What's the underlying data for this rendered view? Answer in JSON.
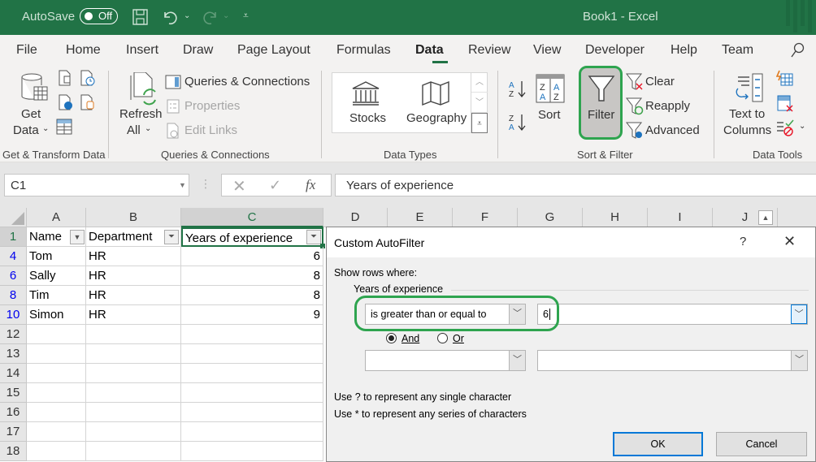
{
  "titlebar": {
    "autosave_label": "AutoSave",
    "autosave_state": "Off",
    "title": "Book1  -  Excel",
    "icons": [
      "save-icon",
      "undo-icon",
      "redo-icon",
      "customize-qat-icon"
    ]
  },
  "menu": {
    "tabs": [
      "File",
      "Home",
      "Insert",
      "Draw",
      "Page Layout",
      "Formulas",
      "Data",
      "Review",
      "View",
      "Developer",
      "Help",
      "Team"
    ],
    "active": "Data",
    "search_icon": "search-icon"
  },
  "ribbon": {
    "get_transform": {
      "get_data_line1": "Get",
      "get_data_line2": "Data",
      "group_label": "Get & Transform Data"
    },
    "queries": {
      "refresh_line1": "Refresh",
      "refresh_line2": "All",
      "queries_connections": "Queries & Connections",
      "properties": "Properties",
      "edit_links": "Edit Links",
      "group_label": "Queries & Connections"
    },
    "data_types": {
      "stocks": "Stocks",
      "geography": "Geography",
      "group_label": "Data Types"
    },
    "sort_filter": {
      "sort": "Sort",
      "filter": "Filter",
      "clear": "Clear",
      "reapply": "Reapply",
      "advanced": "Advanced",
      "group_label": "Sort & Filter"
    },
    "data_tools": {
      "text_to_line1": "Text to",
      "text_to_line2": "Columns",
      "group_label": "Data Tools"
    }
  },
  "formula_bar": {
    "name_box": "C1",
    "formula": "Years of experience",
    "fx": "fx"
  },
  "sheet": {
    "columns": [
      "A",
      "B",
      "C",
      "D",
      "E",
      "F",
      "G",
      "H",
      "I",
      "J"
    ],
    "selected_column": "C",
    "header_row": {
      "row": "1",
      "cells": [
        "Name",
        "Department",
        "Years of experience"
      ]
    },
    "rows": [
      {
        "row": "4",
        "name": "Tom",
        "dept": "HR",
        "years": "6"
      },
      {
        "row": "6",
        "name": "Sally",
        "dept": "HR",
        "years": "8"
      },
      {
        "row": "8",
        "name": "Tim",
        "dept": "HR",
        "years": "8"
      },
      {
        "row": "10",
        "name": "Simon",
        "dept": "HR",
        "years": "9"
      }
    ],
    "empty_rows": [
      "12",
      "13",
      "14",
      "15",
      "16",
      "17",
      "18"
    ]
  },
  "dialog": {
    "title": "Custom AutoFilter",
    "help": "?",
    "close": "✕",
    "show_rows_where": "Show rows where:",
    "field_label": "Years of experience",
    "condition1_operator": "is greater than or equal to",
    "condition1_value": "6",
    "and_label": "And",
    "or_label": "Or",
    "and_selected": true,
    "condition2_operator": "",
    "condition2_value": "",
    "hint1": "Use ? to represent any single character",
    "hint2": "Use * to represent any series of characters",
    "ok": "OK",
    "cancel": "Cancel"
  }
}
